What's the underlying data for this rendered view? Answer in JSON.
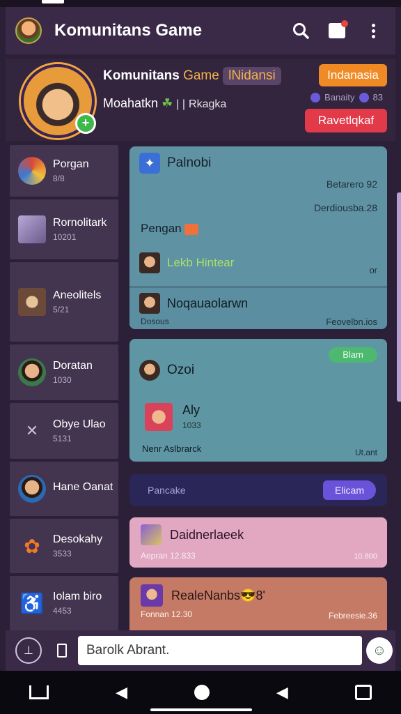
{
  "header": {
    "title": "Komunitans Game",
    "icons": [
      "avatar",
      "search-icon",
      "bag-icon",
      "more-icon"
    ]
  },
  "profile": {
    "title_main": "Komunitans",
    "title_gold": "Game",
    "title_chip": "lNidansi",
    "subtitle": "Moahatkn",
    "subtitle_tag": "Rkagka",
    "btn_orange": "Indanasia",
    "stat": "Banaity",
    "stat_num": "83",
    "btn_red": "Ravetlqkaf"
  },
  "sidebar": {
    "items": [
      {
        "name": "Porgan",
        "num": "8/8"
      },
      {
        "name": "Rornolitark",
        "num": "10201"
      },
      {
        "name": "Aneolitels",
        "num": "5/21"
      },
      {
        "name": "Doratan",
        "num": "1030"
      },
      {
        "name": "Obye Ulao",
        "num": "5131"
      },
      {
        "name": "Hane Oanat",
        "num": ""
      },
      {
        "name": "Desokahy",
        "num": "3533"
      },
      {
        "name": "Iolam biro",
        "num": "4453"
      }
    ]
  },
  "card1": {
    "title": "Palnobi",
    "r1": "Betarero 92",
    "r2": "Derdiousba.28",
    "pengan": "Pengan",
    "green": "Lekb Hintear",
    "row3r": "or",
    "row4": "Noqauaolarwn",
    "foot_l": "Dosous",
    "foot_r": "Feovelbn.ios"
  },
  "card2": {
    "badge": "Blam",
    "name": "Ozoi",
    "sub_name": "Aly",
    "sub_num": "1033",
    "foot_l": "Nenr Aslbrarck",
    "foot_r": "Ut.ant"
  },
  "card3": {
    "text": "Pancake",
    "btn": "Elicam"
  },
  "card4": {
    "title": "Daidnerlaeek",
    "foot_l": "Aepran 12.833",
    "foot_r": "10.800"
  },
  "card5": {
    "title": "RealeNanbs",
    "extra": "8'",
    "foot_l": "Fonnan 12.30",
    "foot_r": "Febreesie.36"
  },
  "input": {
    "value": "Barolk Abrant."
  },
  "colors": {
    "background": "#2c1f38",
    "orange": "#f08a24",
    "red": "#e23a48",
    "teal_card": "#5f93a4",
    "pink_card": "#e2a8c1"
  }
}
